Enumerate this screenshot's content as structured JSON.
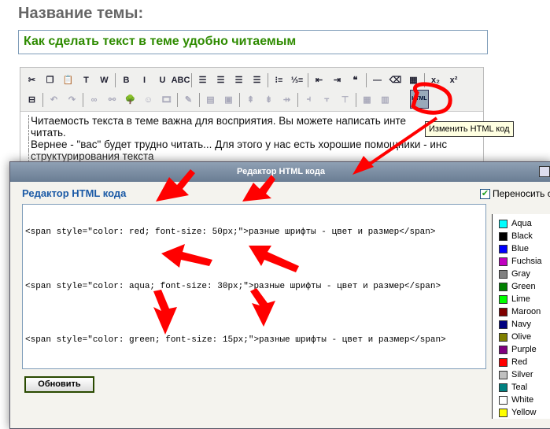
{
  "page": {
    "title": "Название темы:",
    "topic_value": "Как сделать текст в теме удобно читаемым"
  },
  "editor": {
    "content_lines": [
      "Читаемость текста в теме важна для восприятия. Вы можете написать инте",
      "читать.",
      "Вернее - \"вас\" будет трудно читать... Для этого у нас есть хорошие помощники - инс",
      "структурирования текста"
    ],
    "tooltip": "Изменить HTML код",
    "html_button": "HTML",
    "toolbar1": [
      "scissors-icon",
      "copy-icon",
      "paste-icon",
      "paste-text-icon",
      "paste-word-icon",
      "|",
      "B",
      "I",
      "U",
      "ABC",
      "|",
      "align-left-icon",
      "align-center-icon",
      "align-right-icon",
      "justify-icon",
      "|",
      "bullet-list-icon",
      "numbered-list-icon",
      "|",
      "outdent-icon",
      "indent-icon",
      "quote-icon",
      "|",
      "hr-icon",
      "eraser-icon",
      "table-icon",
      "|",
      "x₂",
      "x²"
    ],
    "toolbar2": [
      "pagebreak-icon",
      "|",
      "undo-icon",
      "redo-icon",
      "|",
      "link-icon",
      "unlink-icon",
      "image-icon",
      "smiley-icon",
      "media-icon",
      "|",
      "edit-icon",
      "|",
      "table-props-icon",
      "cell-icon",
      "|",
      "row-before-icon",
      "row-after-icon",
      "delete-row-icon",
      "|",
      "col-before-icon",
      "col-after-icon",
      "delete-col-icon",
      "|",
      "merge-icon",
      "split-icon"
    ]
  },
  "dialog": {
    "title": "Редактор HTML кода",
    "heading": "Редактор HTML кода",
    "wrap_label": "Переносить с",
    "wrap_checked": true,
    "code_lines": [
      "<span style=\"color: red; font-size: 50px;\">разные шрифты - цвет и размер</span>",
      "<span style=\"color: aqua; font-size: 30px;\">разные шрифты - цвет и размер</span>",
      "<span style=\"color: green; font-size: 15px;\">разные шрифты - цвет и размер</span>"
    ],
    "update_button": "Обновить"
  },
  "colors": [
    {
      "name": "Aqua",
      "hex": "#00ffff"
    },
    {
      "name": "Black",
      "hex": "#000000"
    },
    {
      "name": "Blue",
      "hex": "#0000ff"
    },
    {
      "name": "Fuchsia",
      "hex": "#c000c0"
    },
    {
      "name": "Gray",
      "hex": "#808080"
    },
    {
      "name": "Green",
      "hex": "#008000"
    },
    {
      "name": "Lime",
      "hex": "#00ff00"
    },
    {
      "name": "Maroon",
      "hex": "#800000"
    },
    {
      "name": "Navy",
      "hex": "#000080"
    },
    {
      "name": "Olive",
      "hex": "#808000"
    },
    {
      "name": "Purple",
      "hex": "#800080"
    },
    {
      "name": "Red",
      "hex": "#ff0000"
    },
    {
      "name": "Silver",
      "hex": "#c0c0c0"
    },
    {
      "name": "Teal",
      "hex": "#008080"
    },
    {
      "name": "White",
      "hex": "#ffffff"
    },
    {
      "name": "Yellow",
      "hex": "#ffff00"
    }
  ],
  "annotation_color": "#ff0000"
}
